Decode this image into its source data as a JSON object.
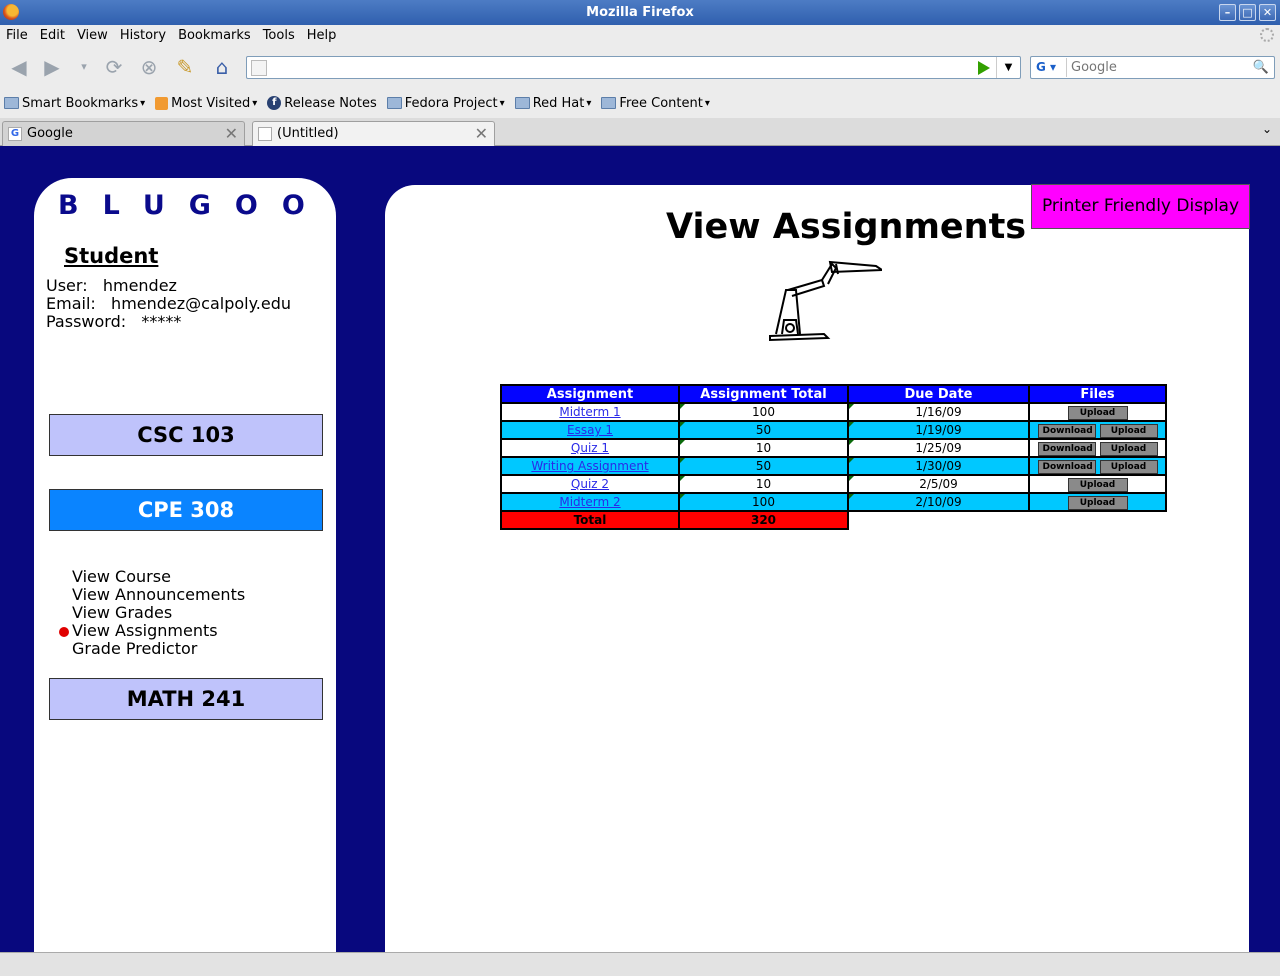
{
  "window": {
    "title": "Mozilla Firefox"
  },
  "menubar": [
    "File",
    "Edit",
    "View",
    "History",
    "Bookmarks",
    "Tools",
    "Help"
  ],
  "urlbar": {
    "value": ""
  },
  "search": {
    "placeholder": "Google",
    "engine_label": "G"
  },
  "bookmarks": [
    "Smart Bookmarks",
    "Most Visited",
    "Release Notes",
    "Fedora Project",
    "Red Hat",
    "Free Content"
  ],
  "tabs": [
    {
      "label": "Google",
      "active": false
    },
    {
      "label": "(Untitled)",
      "active": true
    }
  ],
  "sidebar": {
    "logo": "BLUGOO",
    "section_title": "Student",
    "user_label": "User:",
    "user_value": "hmendez",
    "email_label": "Email:",
    "email_value": "hmendez@calpoly.edu",
    "password_label": "Password:",
    "password_value": "*****",
    "courses": [
      "CSC 103",
      "CPE 308",
      "MATH 241"
    ],
    "course_menu": [
      "View Course",
      "View Announcements",
      "View Grades",
      "View Assignments",
      "Grade Predictor"
    ],
    "active_menu_item": "View Assignments"
  },
  "main": {
    "title": "View Assignments",
    "printer_button": "Printer Friendly Display",
    "table": {
      "headers": [
        "Assignment",
        "Assignment Total",
        "Due Date",
        "Files"
      ],
      "rows": [
        {
          "name": "Midterm 1",
          "total": "100",
          "due": "1/16/09",
          "files": [
            "Upload"
          ]
        },
        {
          "name": "Essay 1",
          "total": "50",
          "due": "1/19/09",
          "files": [
            "Download",
            "Upload"
          ]
        },
        {
          "name": "Quiz 1",
          "total": "10",
          "due": "1/25/09",
          "files": [
            "Download",
            "Upload"
          ]
        },
        {
          "name": "Writing Assignment",
          "total": "50",
          "due": "1/30/09",
          "files": [
            "Download",
            "Upload"
          ]
        },
        {
          "name": "Quiz 2",
          "total": "10",
          "due": "2/5/09",
          "files": [
            "Upload"
          ]
        },
        {
          "name": "Midterm 2",
          "total": "100",
          "due": "2/10/09",
          "files": [
            "Upload"
          ]
        }
      ],
      "total_label": "Total",
      "total_value": "320"
    }
  },
  "colors": {
    "page_background": "#08087e",
    "table_header": "#0404ff",
    "row_alt": "#00c8ff",
    "total_row": "#ff0000",
    "printer_button": "#ff00ff",
    "course_active": "#0a84ff",
    "course_inactive": "#bfc3fb"
  }
}
